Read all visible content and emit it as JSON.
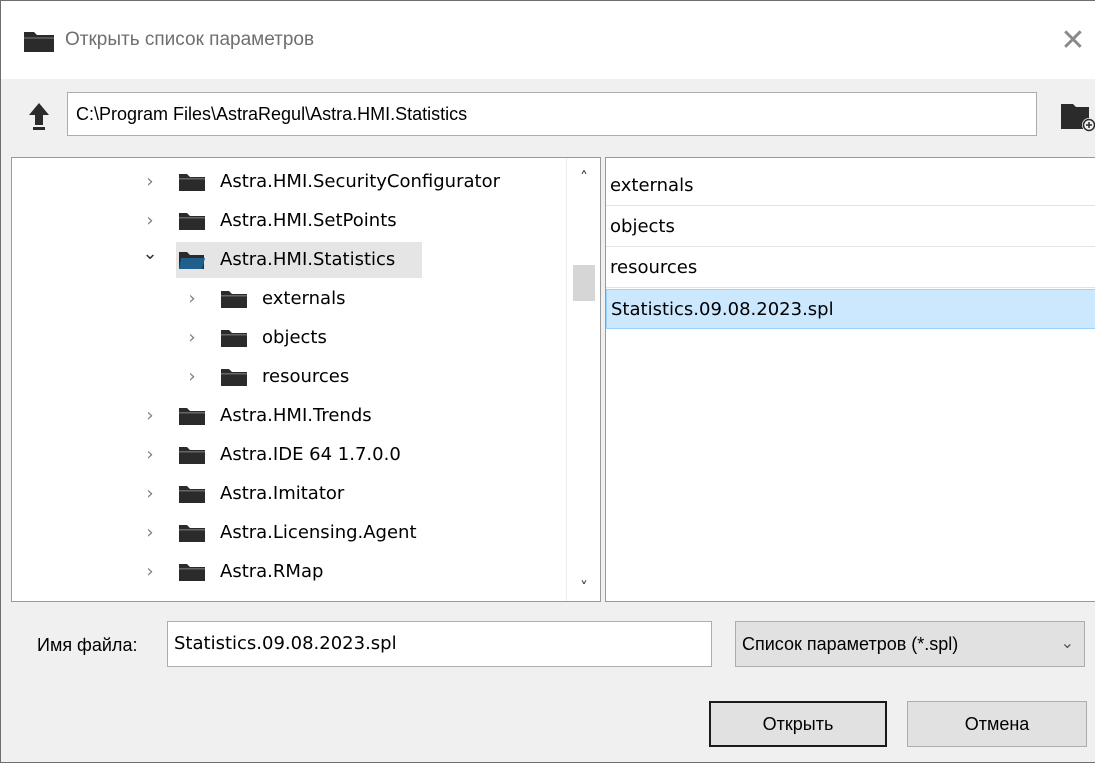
{
  "window": {
    "title": "Открыть список параметров",
    "close_glyph": "✕"
  },
  "toolbar": {
    "path": "C:\\Program Files\\AstraRegul\\Astra.HMI.Statistics",
    "up_icon": "up-arrow-icon",
    "new_folder_icon": "new-folder-icon"
  },
  "tree": {
    "items": [
      {
        "label": "Astra.HMI.SecurityConfigurator",
        "expanded": false,
        "level": 0,
        "selected": false
      },
      {
        "label": "Astra.HMI.SetPoints",
        "expanded": false,
        "level": 0,
        "selected": false
      },
      {
        "label": "Astra.HMI.Statistics",
        "expanded": true,
        "level": 0,
        "selected": true
      },
      {
        "label": "externals",
        "expanded": false,
        "level": 1,
        "selected": false
      },
      {
        "label": "objects",
        "expanded": false,
        "level": 1,
        "selected": false
      },
      {
        "label": "resources",
        "expanded": false,
        "level": 1,
        "selected": false
      },
      {
        "label": "Astra.HMI.Trends",
        "expanded": false,
        "level": 0,
        "selected": false
      },
      {
        "label": "Astra.IDE 64 1.7.0.0",
        "expanded": false,
        "level": 0,
        "selected": false
      },
      {
        "label": "Astra.Imitator",
        "expanded": false,
        "level": 0,
        "selected": false
      },
      {
        "label": "Astra.Licensing.Agent",
        "expanded": false,
        "level": 0,
        "selected": false
      },
      {
        "label": "Astra.RMap",
        "expanded": false,
        "level": 0,
        "selected": false
      }
    ]
  },
  "files": {
    "items": [
      {
        "label": "externals",
        "selected": false
      },
      {
        "label": "objects",
        "selected": false
      },
      {
        "label": "resources",
        "selected": false
      },
      {
        "label": "Statistics.09.08.2023.spl",
        "selected": true
      }
    ]
  },
  "footer": {
    "filename_label": "Имя файла:",
    "filename_value": "Statistics.09.08.2023.spl",
    "filter_value": "Список параметров (*.spl)",
    "open_label": "Открыть",
    "cancel_label": "Отмена"
  },
  "colors": {
    "folder": "#2b2b2b",
    "folder_open": "#1f5f8b",
    "selection": "#cce8ff",
    "tree_selection": "#e5e5e5"
  }
}
